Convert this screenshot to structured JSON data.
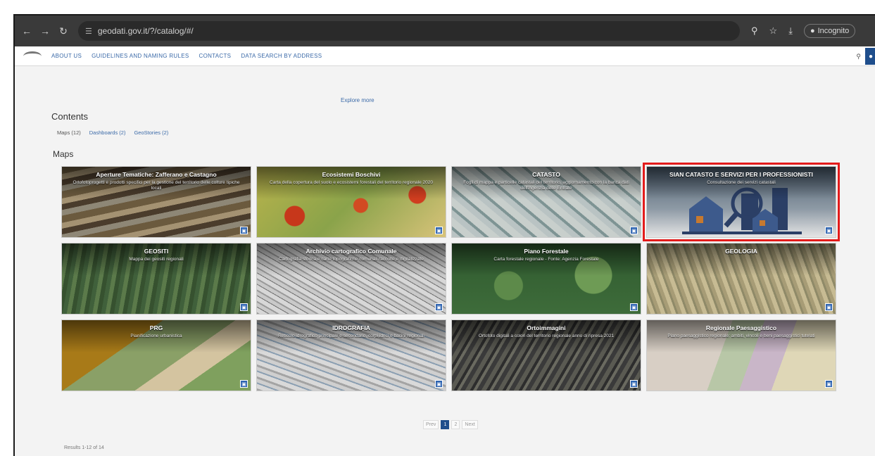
{
  "browser": {
    "url": "geodati.gov.it/?/catalog/#/",
    "incognito_label": "Incognito"
  },
  "site_nav": {
    "items": [
      "ABOUT US",
      "GUIDELINES AND NAMING RULES",
      "CONTACTS",
      "DATA SEARCH BY ADDRESS"
    ]
  },
  "content": {
    "show_more": "Explore more",
    "contents_title": "Contents",
    "filters": [
      {
        "label": "Maps (12)",
        "active": true
      },
      {
        "label": "Dashboards (2)",
        "active": false
      },
      {
        "label": "GeoStories (2)",
        "active": false
      }
    ],
    "maps_title": "Maps"
  },
  "cards": [
    {
      "title": "Aperture Tematiche: Zafferano e Castagno",
      "desc": "Ortofotoprogetti e prodotti specifici per la gestione del territorio delle colture tipiche locali"
    },
    {
      "title": "Ecosistemi Boschivi",
      "desc": "Carta della copertura del suolo e ecosistemi forestali del territorio regionale 2020"
    },
    {
      "title": "CATASTO",
      "desc": "Fogli di mappa e particelle catastali del territorio, aggiornamento con la banca dati dell'Agenzia delle Entrate"
    },
    {
      "title": "SIAN CATASTO E SERVIZI PER I PROFESSIONISTI",
      "desc": "Consultazione dei servizi catastali"
    },
    {
      "title": "GEOSITI",
      "desc": "Mappa dei geositi regionali"
    },
    {
      "title": "Archivio cartografico Comunale",
      "desc": "Cartografia storica e carte topografiche comunali raccolte e digitalizzate"
    },
    {
      "title": "Piano Forestale",
      "desc": "Carta forestale regionale - Fonte: Agenzia Forestale"
    },
    {
      "title": "GEOLOGIA",
      "desc": ""
    },
    {
      "title": "PRG",
      "desc": "Pianificazione urbanistica"
    },
    {
      "title": "IDROGRAFIA",
      "desc": "Reticolo idrografico principale e secondario, corpi idrici e bacini regionali"
    },
    {
      "title": "Ortoimmagini",
      "desc": "Ortofoto digitali a colori del territorio regionale anno di ripresa 2021"
    },
    {
      "title": "Regionale Paesaggistico",
      "desc": "Piano paesaggistico regionale: ambiti, vincoli e beni paesaggistici tutelati"
    }
  ],
  "pagination": {
    "prev": "Prev",
    "pages": [
      "1",
      "2"
    ],
    "active": "1",
    "next": "Next"
  },
  "footer": {
    "text": "Results 1-12 of 14"
  },
  "colors": {
    "highlight": "#e31b1b",
    "accent": "#1f4e8c",
    "link": "#3b6aa8"
  }
}
